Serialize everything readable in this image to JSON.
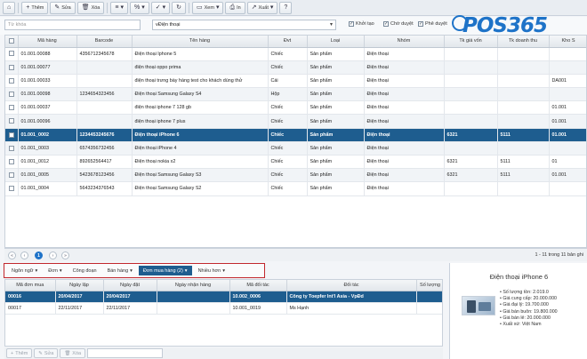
{
  "toolbar": {
    "home_icon": "home-icon",
    "buttons": [
      {
        "label": "Thêm",
        "icon": "+"
      },
      {
        "label": "Sửa",
        "icon": "✎"
      },
      {
        "label": "Xóa",
        "icon": "🗑"
      },
      {
        "label": "",
        "icon": "≡"
      },
      {
        "label": "",
        "icon": "%"
      },
      {
        "label": "",
        "icon": "✓"
      },
      {
        "label": "",
        "icon": "↻"
      },
      {
        "label": "Xem",
        "icon": "▭"
      },
      {
        "label": "In",
        "icon": "⎙"
      },
      {
        "label": "Xuất",
        "icon": "↗"
      },
      {
        "label": "",
        "icon": "?"
      }
    ]
  },
  "filters": {
    "keyword_placeholder": "Từ khóa",
    "category_value": "vĐiện thoại",
    "checks": [
      "Khởi tạo",
      "Chờ duyệt",
      "Phê duyệt"
    ]
  },
  "logo": {
    "text": "POS365"
  },
  "grid": {
    "headers": [
      "Mã hàng",
      "Barcode",
      "Tên hàng",
      "Đvt",
      "Loại",
      "Nhóm",
      "Tk giá vốn",
      "Tk doanh thu",
      "Kho S"
    ],
    "rows": [
      [
        "01.001.00088",
        "4356712345678",
        "Điện thoại Iphone 5",
        "Chiếc",
        "Sản phẩm",
        "Điện thoại",
        "",
        "",
        ""
      ],
      [
        "01.001.00077",
        "",
        "điện thoại oppo prima",
        "Chiếc",
        "Sản phẩm",
        "Điện thoại",
        "",
        "",
        ""
      ],
      [
        "01.001.00033",
        "",
        "điện thoại trưng bày hàng test cho khách dùng thử",
        "Cái",
        "Sản phẩm",
        "Điện thoại",
        "",
        "",
        "DA001"
      ],
      [
        "01.001.00098",
        "1234654323456",
        "Điện thoại Samsung Galaxy S4",
        "Hộp",
        "Sản phẩm",
        "Điện thoại",
        "",
        "",
        ""
      ],
      [
        "01.001.00037",
        "",
        "điện thoại iphone 7 128 gb",
        "Chiếc",
        "Sản phẩm",
        "Điện thoại",
        "",
        "",
        "01.001"
      ],
      [
        "01.001.00096",
        "",
        "điện thoại iphone 7 plus",
        "Chiếc",
        "Sản phẩm",
        "Điện thoại",
        "",
        "",
        "01.001"
      ],
      [
        "01.001_0002",
        "1234453245676",
        "Điện thoại iPhone 6",
        "Chiếc",
        "Sản phẩm",
        "Điện thoại",
        "6321",
        "5111",
        "01.001"
      ],
      [
        "01.001_0003",
        "6574356732456",
        "Điện thoại iPhone 4",
        "Chiếc",
        "Sản phẩm",
        "Điện thoại",
        "",
        "",
        ""
      ],
      [
        "01.001_0012",
        "892652564417",
        "Điện thoại nokia x2",
        "Chiếc",
        "Sản phẩm",
        "Điện thoại",
        "6321",
        "5111",
        "01"
      ],
      [
        "01.001_0005",
        "5423678123456",
        "Điện thoại Samsung Galaxy S3",
        "Chiếc",
        "Sản phẩm",
        "Điện thoại",
        "6321",
        "5111",
        "01.001"
      ],
      [
        "01.001_0004",
        "5643234376543",
        "Điện thoại Samsung Galaxy S2",
        "Chiếc",
        "Sản phẩm",
        "Điện thoại",
        "",
        "",
        ""
      ]
    ],
    "selected_index": 6
  },
  "pager": {
    "current": "1",
    "info": "1 - 11 trong 11 bản ghi"
  },
  "tabs": [
    {
      "label": "Ngôn ngữ",
      "active": false
    },
    {
      "label": "Đơn",
      "active": false
    },
    {
      "label": "Công đoạn",
      "active": false
    },
    {
      "label": "Bán hàng",
      "active": false
    },
    {
      "label": "Đơn mua hàng (2)",
      "active": true
    },
    {
      "label": "Nhiều hơn",
      "active": false
    }
  ],
  "detail": {
    "headers": [
      "Mã đơn mua",
      "Ngày lập",
      "Ngày đặt",
      "Ngày nhận hàng",
      "Mã đối tác",
      "Đối tác",
      "Số lượng"
    ],
    "rows": [
      [
        "00016",
        "20/04/2017",
        "20/04/2017",
        "",
        "10.002_0006",
        "Công ty Toepfer Int'l Asia - VpĐd",
        ""
      ],
      [
        "00017",
        "22/11/2017",
        "22/11/2017",
        "",
        "10.001_0019",
        "Ms Hạnh",
        ""
      ]
    ],
    "selected_index": 0
  },
  "bottombar": {
    "add": "Thêm",
    "edit": "Sửa",
    "delete": "Xóa"
  },
  "product": {
    "title": "Điện thoại iPhone 6",
    "details": [
      "Số lượng tồn: 2.019.0",
      "Giá cung cấp: 20.000.000",
      "Giá đại lý: 19.700.000",
      "Giá bán buôn: 19.800.000",
      "Giá bán lẻ: 20.000.000",
      "Xuất xứ: Việt Nam"
    ]
  },
  "colors": {
    "accent": "#1e5d8f",
    "brand": "#1e73c8",
    "highlight": "#c1272d"
  }
}
